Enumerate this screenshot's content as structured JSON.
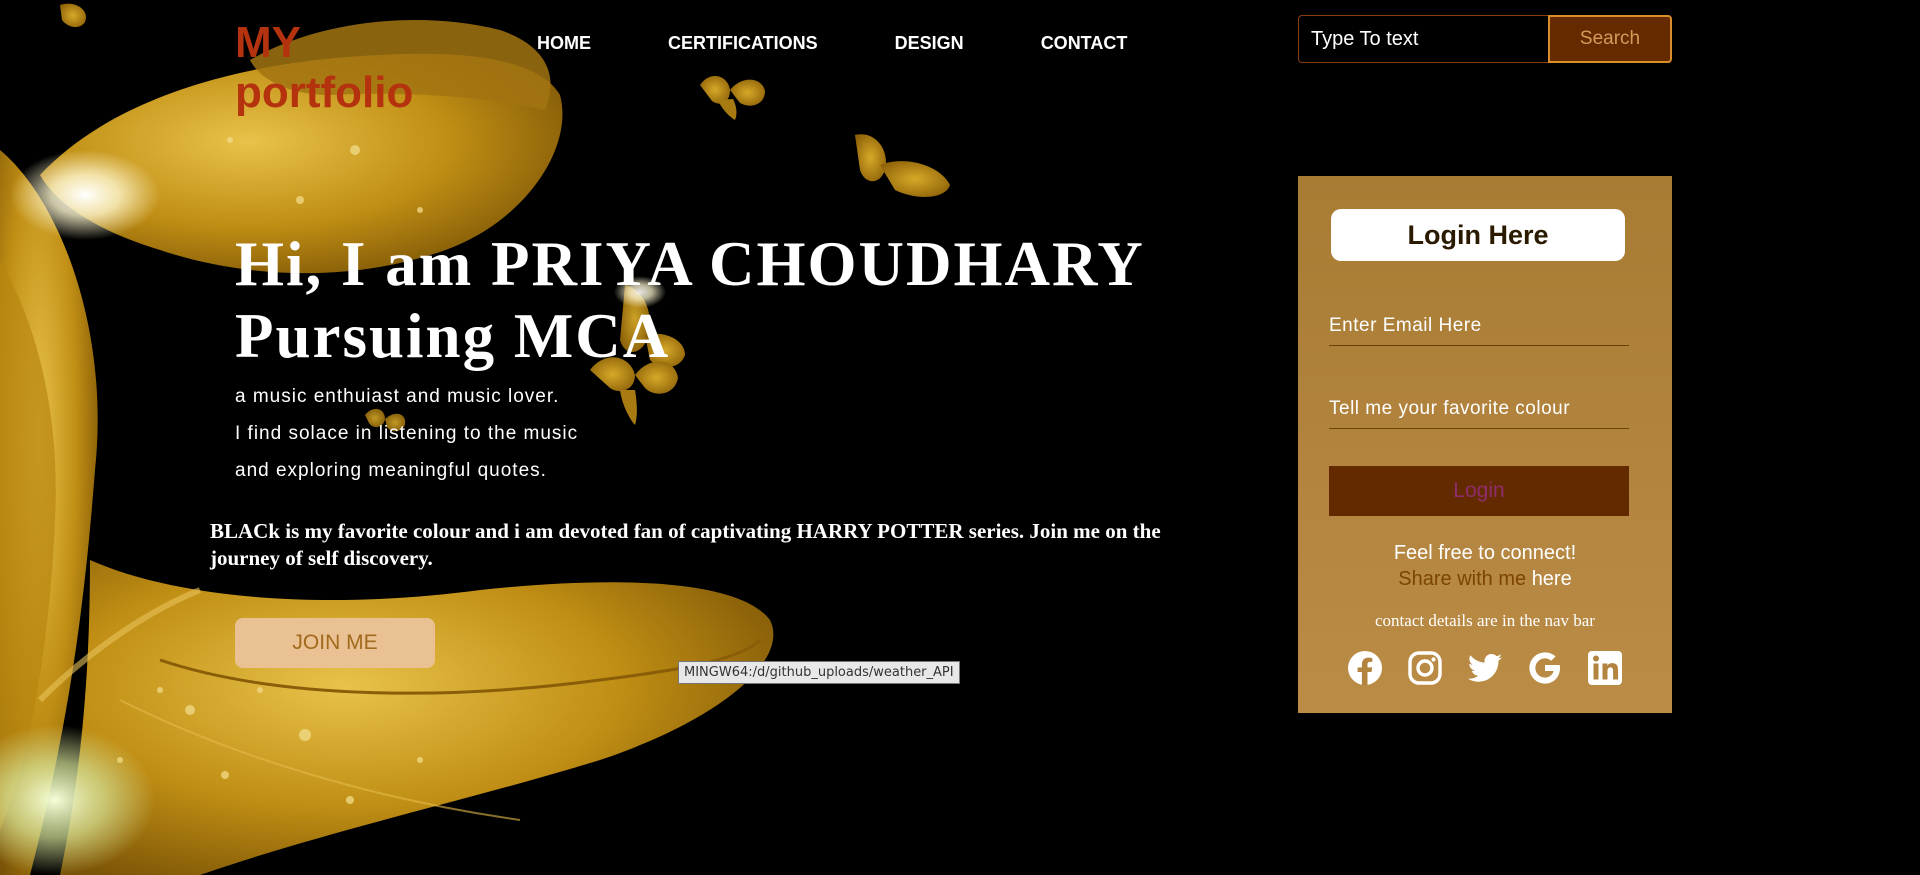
{
  "logo": {
    "line1": "MY",
    "line2": "portfolio"
  },
  "nav": {
    "items": [
      {
        "label": "HOME"
      },
      {
        "label": "CERTIFICATIONS"
      },
      {
        "label": "DESIGN"
      },
      {
        "label": "CONTACT"
      }
    ]
  },
  "search": {
    "placeholder": "Type To text",
    "button_label": "Search"
  },
  "hero": {
    "title_line1": "Hi, I am PRIYA CHOUDHARY",
    "title_line2": "Pursuing MCA",
    "tagline": [
      "a music enthuiast and music lover.",
      "I find solace in listening to the music",
      "and exploring meaningful quotes."
    ],
    "about": "BLACk is my favorite colour and i am devoted fan of captivating HARRY POTTER series. Join me on the journey of self discovery.",
    "join_label": "JOIN ME"
  },
  "tooltip": {
    "text": "MINGW64:/d/github_uploads/weather_API"
  },
  "login": {
    "title": "Login Here",
    "email_placeholder": "Enter Email Here",
    "colour_placeholder": "Tell me your favorite colour",
    "button_label": "Login",
    "connect_text": "Feel free to connect!",
    "share_text": "Share with me",
    "here_link": "here",
    "contact_note": "contact details are in the nav bar",
    "socials": [
      {
        "icon": "facebook-icon"
      },
      {
        "icon": "instagram-icon"
      },
      {
        "icon": "twitter-icon"
      },
      {
        "icon": "google-icon"
      },
      {
        "icon": "linkedin-icon"
      }
    ]
  },
  "colors": {
    "background": "#000000",
    "logo": "#b5320e",
    "panel": "#b2843f",
    "login_button": "#632a00",
    "join_button": "#eac192",
    "butterfly_gold": "#c9961a"
  }
}
